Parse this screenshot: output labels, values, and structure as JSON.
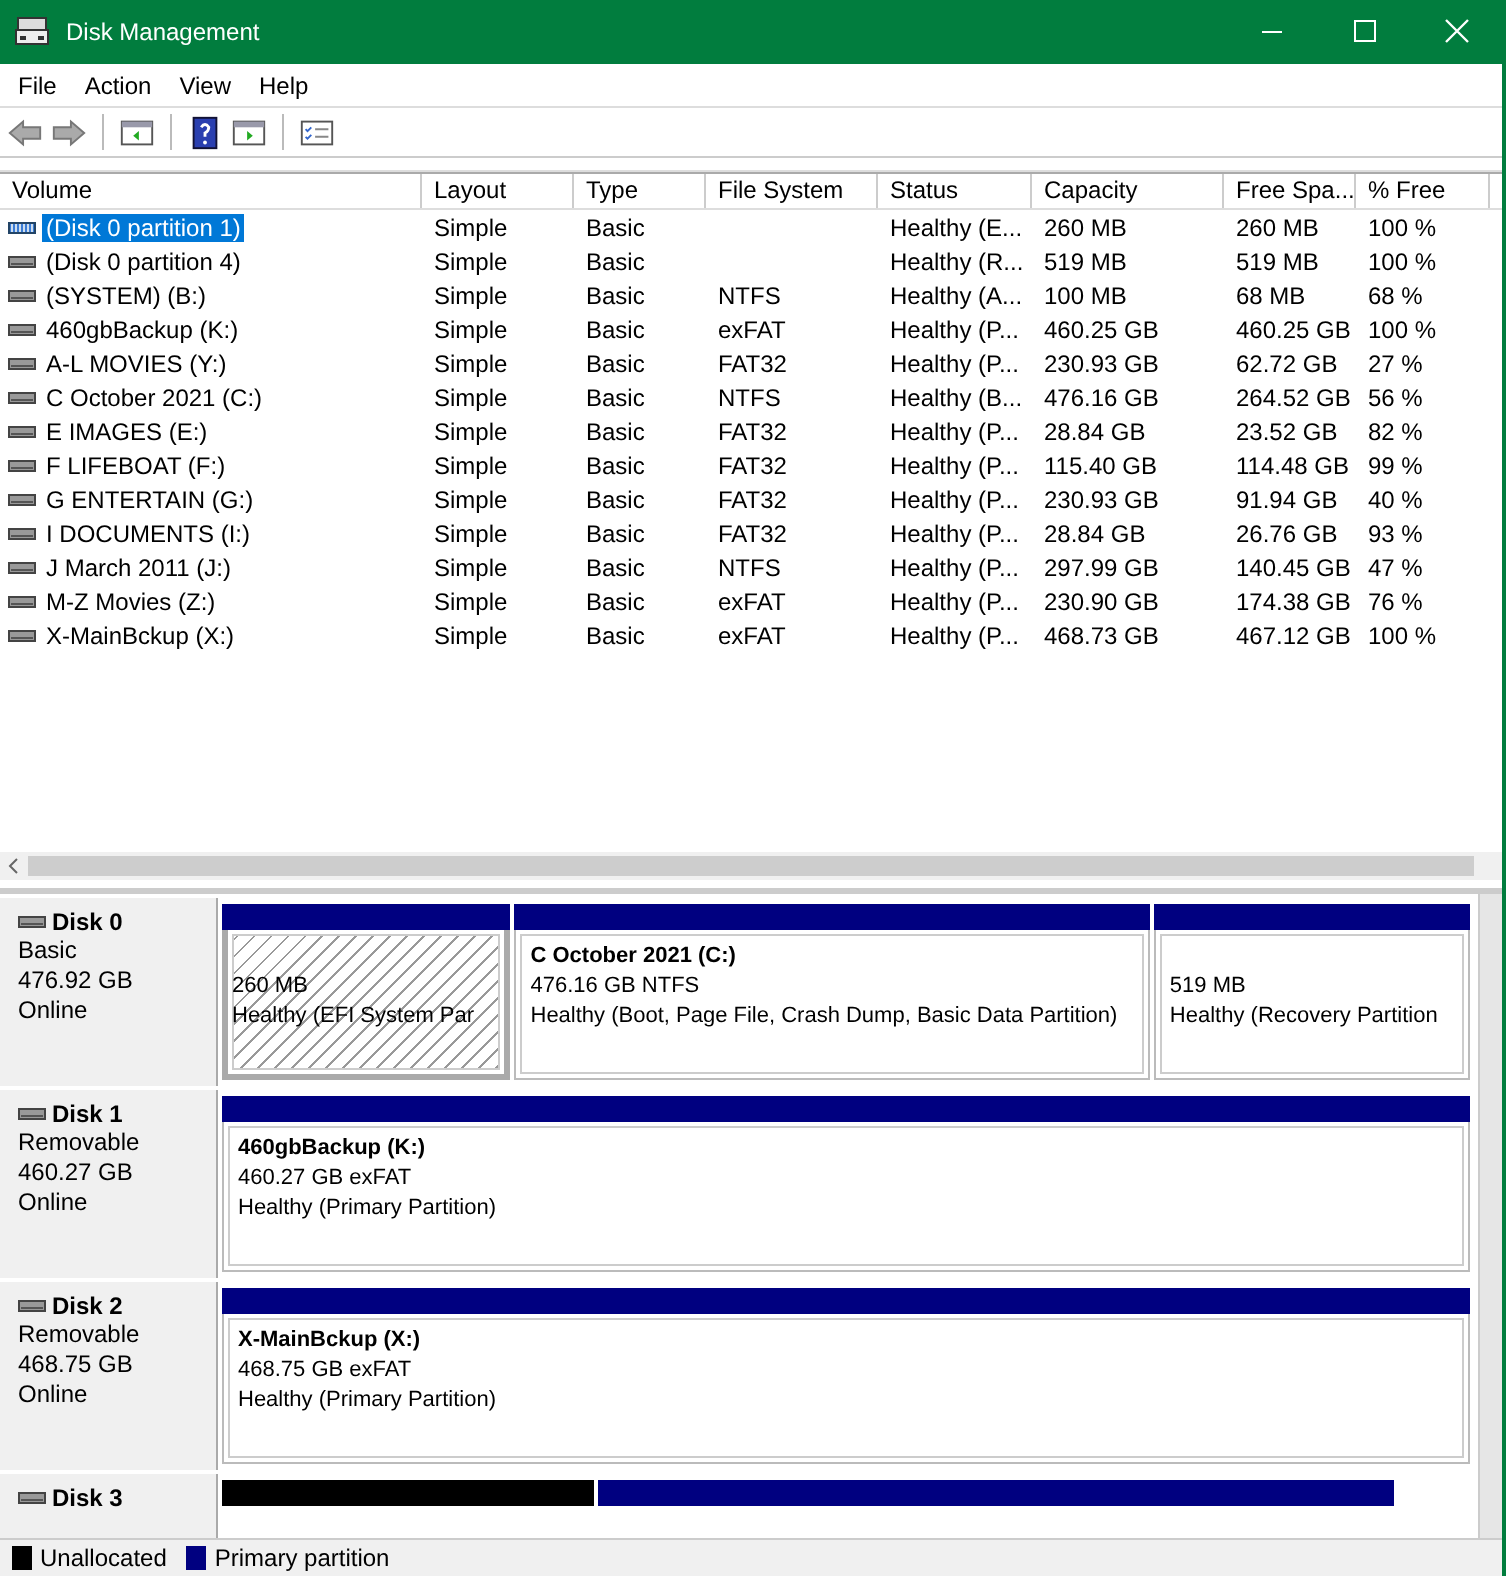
{
  "window": {
    "title": "Disk Management"
  },
  "menu": [
    "File",
    "Action",
    "View",
    "Help"
  ],
  "table": {
    "columns": [
      "Volume",
      "Layout",
      "Type",
      "File System",
      "Status",
      "Capacity",
      "Free Spa...",
      "% Free"
    ],
    "rows": [
      {
        "selected": true,
        "cells": [
          "(Disk 0 partition 1)",
          "Simple",
          "Basic",
          "",
          "Healthy (E...",
          "260 MB",
          "260 MB",
          "100 %"
        ]
      },
      {
        "selected": false,
        "cells": [
          "(Disk 0 partition 4)",
          "Simple",
          "Basic",
          "",
          "Healthy (R...",
          "519 MB",
          "519 MB",
          "100 %"
        ]
      },
      {
        "selected": false,
        "cells": [
          "(SYSTEM) (B:)",
          "Simple",
          "Basic",
          "NTFS",
          "Healthy (A...",
          "100 MB",
          "68 MB",
          "68 %"
        ]
      },
      {
        "selected": false,
        "cells": [
          "460gbBackup (K:)",
          "Simple",
          "Basic",
          "exFAT",
          "Healthy (P...",
          "460.25 GB",
          "460.25 GB",
          "100 %"
        ]
      },
      {
        "selected": false,
        "cells": [
          "A-L MOVIES (Y:)",
          "Simple",
          "Basic",
          "FAT32",
          "Healthy (P...",
          "230.93 GB",
          "62.72 GB",
          "27 %"
        ]
      },
      {
        "selected": false,
        "cells": [
          "C October 2021 (C:)",
          "Simple",
          "Basic",
          "NTFS",
          "Healthy (B...",
          "476.16 GB",
          "264.52 GB",
          "56 %"
        ]
      },
      {
        "selected": false,
        "cells": [
          "E IMAGES (E:)",
          "Simple",
          "Basic",
          "FAT32",
          "Healthy (P...",
          "28.84 GB",
          "23.52 GB",
          "82 %"
        ]
      },
      {
        "selected": false,
        "cells": [
          "F LIFEBOAT (F:)",
          "Simple",
          "Basic",
          "FAT32",
          "Healthy (P...",
          "115.40 GB",
          "114.48 GB",
          "99 %"
        ]
      },
      {
        "selected": false,
        "cells": [
          "G ENTERTAIN (G:)",
          "Simple",
          "Basic",
          "FAT32",
          "Healthy (P...",
          "230.93 GB",
          "91.94 GB",
          "40 %"
        ]
      },
      {
        "selected": false,
        "cells": [
          "I DOCUMENTS (I:)",
          "Simple",
          "Basic",
          "FAT32",
          "Healthy (P...",
          "28.84 GB",
          "26.76 GB",
          "93 %"
        ]
      },
      {
        "selected": false,
        "cells": [
          "J March 2011 (J:)",
          "Simple",
          "Basic",
          "NTFS",
          "Healthy (P...",
          "297.99 GB",
          "140.45 GB",
          "47 %"
        ]
      },
      {
        "selected": false,
        "cells": [
          "M-Z Movies (Z:)",
          "Simple",
          "Basic",
          "exFAT",
          "Healthy (P...",
          "230.90 GB",
          "174.38 GB",
          "76 %"
        ]
      },
      {
        "selected": false,
        "cells": [
          "X-MainBckup (X:)",
          "Simple",
          "Basic",
          "exFAT",
          "Healthy (P...",
          "468.73 GB",
          "467.12 GB",
          "100 %"
        ]
      }
    ]
  },
  "disks": [
    {
      "name": "Disk 0",
      "type": "Basic",
      "size": "476.92 GB",
      "status": "Online",
      "partitions": [
        {
          "kind": "primary",
          "selected": true,
          "lines": [
            "260 MB",
            "Healthy (EFI System Par"
          ]
        },
        {
          "kind": "primary",
          "selected": false,
          "title": "C October 2021  (C:)",
          "lines": [
            "476.16 GB NTFS",
            "Healthy (Boot, Page File, Crash Dump, Basic Data Partition)"
          ]
        },
        {
          "kind": "primary",
          "selected": false,
          "lines": [
            "519 MB",
            "Healthy (Recovery Partition"
          ]
        }
      ]
    },
    {
      "name": "Disk 1",
      "type": "Removable",
      "size": "460.27 GB",
      "status": "Online",
      "partitions": [
        {
          "kind": "primary",
          "selected": false,
          "title": "460gbBackup  (K:)",
          "lines": [
            "460.27 GB exFAT",
            "Healthy (Primary Partition)"
          ]
        }
      ]
    },
    {
      "name": "Disk 2",
      "type": "Removable",
      "size": "468.75 GB",
      "status": "Online",
      "partitions": [
        {
          "kind": "primary",
          "selected": false,
          "title": "X-MainBckup  (X:)",
          "lines": [
            "468.75 GB exFAT",
            "Healthy (Primary Partition)"
          ]
        }
      ]
    },
    {
      "name": "Disk 3",
      "partitions": [
        {
          "kind": "unallocated"
        },
        {
          "kind": "primary"
        }
      ]
    }
  ],
  "legend": [
    {
      "label": "Unallocated",
      "color": "#000000"
    },
    {
      "label": "Primary partition",
      "color": "#000080"
    }
  ]
}
